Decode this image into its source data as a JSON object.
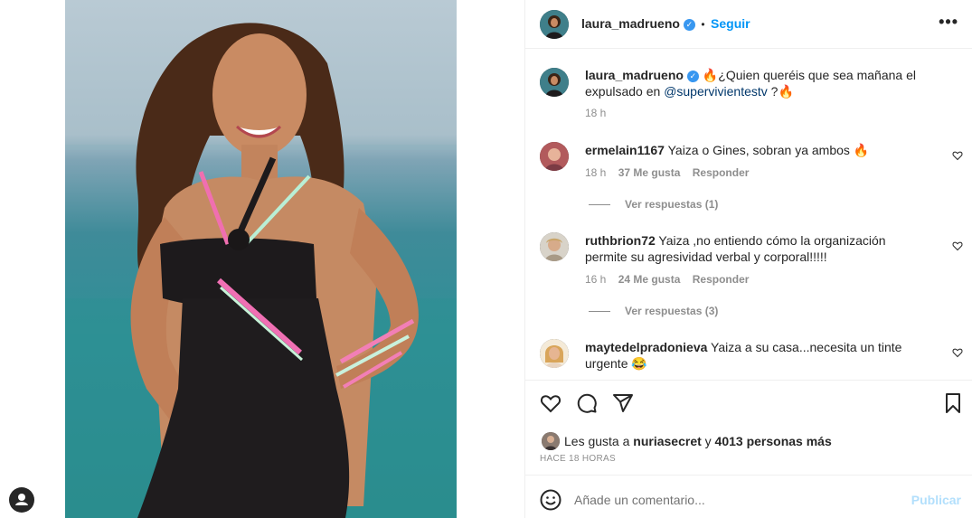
{
  "post": {
    "author": "laura_madrueno",
    "follow_label": "Seguir",
    "separator": "•",
    "more_label": "•••",
    "verified_mark": "✓",
    "caption_lead": "¿Quien queréis que sea mañana el expulsado en ",
    "caption_mention": "@supervivientestv",
    "caption_tail": " ?",
    "caption_time": "18 h",
    "fire_emoji": "🔥"
  },
  "comments": [
    {
      "user": "ermelain1167",
      "text": "Yaiza o Gines, sobran ya ambos",
      "emoji": "🔥",
      "time": "18 h",
      "likes": "37 Me gusta",
      "reply_label": "Responder",
      "view_replies": "Ver respuestas (1)"
    },
    {
      "user": "ruthbrion72",
      "text": "Yaiza ,no entiendo cómo la organización permite su agresividad verbal y corporal!!!!!",
      "emoji": "",
      "time": "16 h",
      "likes": "24 Me gusta",
      "reply_label": "Responder",
      "view_replies": "Ver respuestas (3)"
    },
    {
      "user": "maytedelpradonieva",
      "text": "Yaiza a su casa...necesita un tinte urgente",
      "emoji": "😂",
      "time": "",
      "likes": "",
      "reply_label": "",
      "view_replies": ""
    }
  ],
  "likes": {
    "prefix": "Les gusta a",
    "liker": "nuriasecret",
    "joiner": "y",
    "others": "4013 personas más",
    "posted_ago": "HACE 18 HORAS"
  },
  "comment_box": {
    "placeholder": "Añade un comentario...",
    "publish_label": "Publicar"
  },
  "icons": [
    "heart-icon",
    "comment-icon",
    "share-icon",
    "bookmark-icon",
    "emoji-icon",
    "more-icon",
    "verified-icon",
    "profile-icon"
  ],
  "colors": {
    "accent": "#0095f6",
    "verified": "#3897f0",
    "publish_disabled": "#b2dffc",
    "meta_text": "#8e8e8e",
    "link": "#00376b"
  }
}
